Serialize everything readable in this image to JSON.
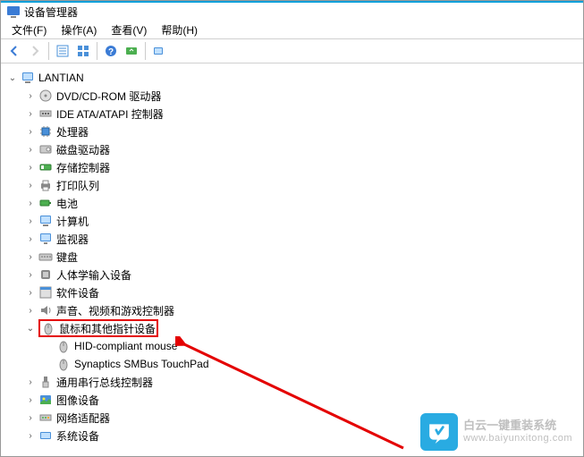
{
  "window": {
    "title": "设备管理器"
  },
  "menu": {
    "file": "文件(F)",
    "action": "操作(A)",
    "view": "查看(V)",
    "help": "帮助(H)"
  },
  "toolbar_icons": {
    "back": "back-arrow-icon",
    "forward": "forward-arrow-icon",
    "properties": "properties-icon",
    "details": "details-icon",
    "help": "help-icon",
    "scan": "scan-hardware-icon",
    "show": "show-hidden-icon"
  },
  "tree": {
    "root": "LANTIAN",
    "items": [
      {
        "icon": "disc",
        "label": "DVD/CD-ROM 驱动器"
      },
      {
        "icon": "ide",
        "label": "IDE ATA/ATAPI 控制器"
      },
      {
        "icon": "cpu",
        "label": "处理器"
      },
      {
        "icon": "disk",
        "label": "磁盘驱动器"
      },
      {
        "icon": "storage",
        "label": "存储控制器"
      },
      {
        "icon": "printer",
        "label": "打印队列"
      },
      {
        "icon": "battery",
        "label": "电池"
      },
      {
        "icon": "computer",
        "label": "计算机"
      },
      {
        "icon": "monitor",
        "label": "监视器"
      },
      {
        "icon": "keyboard",
        "label": "键盘"
      },
      {
        "icon": "hid",
        "label": "人体学输入设备"
      },
      {
        "icon": "software",
        "label": "软件设备"
      },
      {
        "icon": "audio",
        "label": "声音、视频和游戏控制器"
      },
      {
        "icon": "mouse",
        "label": "鼠标和其他指针设备",
        "highlight": true,
        "expanded": true,
        "children": [
          {
            "icon": "mouse",
            "label": "HID-compliant mouse"
          },
          {
            "icon": "mouse",
            "label": "Synaptics SMBus TouchPad"
          }
        ]
      },
      {
        "icon": "usb",
        "label": "通用串行总线控制器"
      },
      {
        "icon": "image",
        "label": "图像设备"
      },
      {
        "icon": "network",
        "label": "网络适配器"
      },
      {
        "icon": "system",
        "label": "系统设备"
      }
    ]
  },
  "watermark": {
    "line1": "白云一键重装系统",
    "line2": "www.baiyunxitong.com"
  }
}
